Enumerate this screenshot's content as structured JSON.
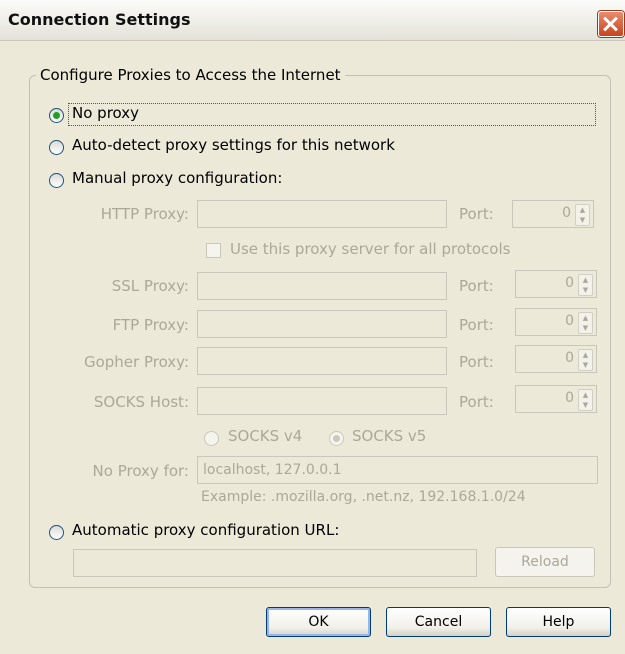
{
  "window": {
    "title": "Connection Settings"
  },
  "group": {
    "legend": "Configure Proxies to Access the Internet"
  },
  "options": {
    "no_proxy": "No proxy",
    "auto_detect": "Auto-detect proxy settings for this network",
    "manual": "Manual proxy configuration:",
    "auto_url": "Automatic proxy configuration URL:"
  },
  "manual": {
    "http": {
      "label": "HTTP Proxy:",
      "value": "",
      "port_label": "Port:",
      "port": "0"
    },
    "share_checkbox": "Use this proxy server for all protocols",
    "ssl": {
      "label": "SSL Proxy:",
      "value": "",
      "port_label": "Port:",
      "port": "0"
    },
    "ftp": {
      "label": "FTP Proxy:",
      "value": "",
      "port_label": "Port:",
      "port": "0"
    },
    "gopher": {
      "label": "Gopher Proxy:",
      "value": "",
      "port_label": "Port:",
      "port": "0"
    },
    "socks": {
      "label": "SOCKS Host:",
      "value": "",
      "port_label": "Port:",
      "port": "0"
    },
    "socks_v4": "SOCKS v4",
    "socks_v5": "SOCKS v5",
    "no_proxy_label": "No Proxy for:",
    "no_proxy_value": "localhost, 127.0.0.1",
    "example": "Example: .mozilla.org, .net.nz, 192.168.1.0/24"
  },
  "auto_url_value": "",
  "buttons": {
    "reload": "Reload",
    "ok": "OK",
    "cancel": "Cancel",
    "help": "Help"
  },
  "colors": {
    "dialog_bg": "#ece9d8",
    "radio_checked": "#21a121",
    "disabled_text": "#aca899"
  }
}
